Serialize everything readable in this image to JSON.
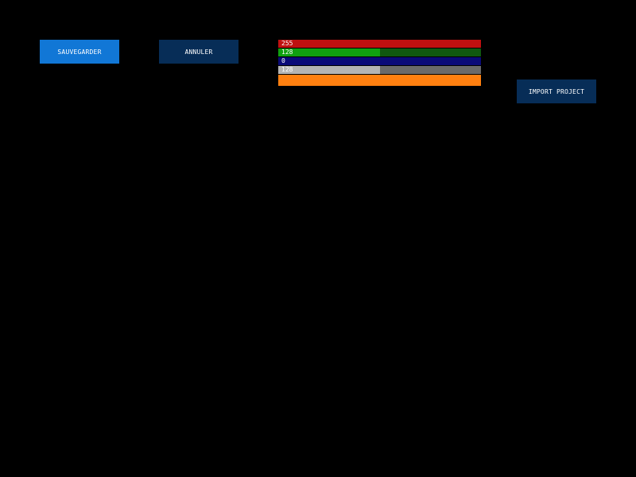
{
  "buttons": {
    "save": {
      "label": "SAUVEGARDER",
      "bg": "#1177d6"
    },
    "cancel": {
      "label": "ANNULER",
      "bg": "#072d57"
    },
    "import": {
      "label": "IMPORT PROJECT",
      "bg": "#072d57"
    }
  },
  "color_picker": {
    "max": 255,
    "channels": [
      {
        "name": "red",
        "value": 255,
        "fill": "#c01010",
        "track": "#701010"
      },
      {
        "name": "green",
        "value": 128,
        "fill": "#10a010",
        "track": "#105810"
      },
      {
        "name": "blue",
        "value": 0,
        "fill": "#1010c0",
        "track": "#0a0a78"
      },
      {
        "name": "alpha",
        "value": 128,
        "fill": "#b4b4b4",
        "track": "#6a6a6a"
      }
    ],
    "labels": [
      "255",
      "128",
      "0",
      "128"
    ],
    "preview_color": "#ff8010"
  }
}
